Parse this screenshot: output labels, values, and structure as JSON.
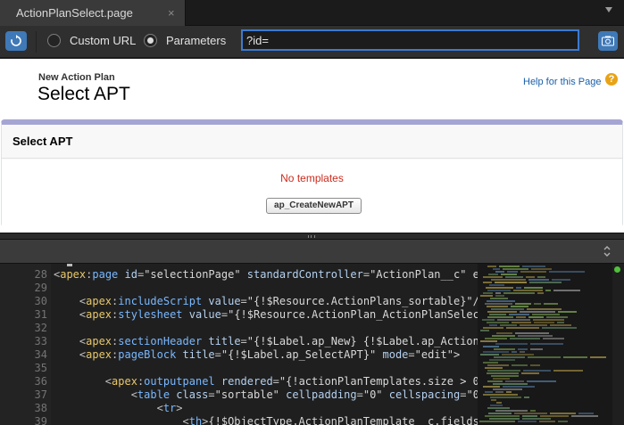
{
  "tab": {
    "title": "ActionPlanSelect.page",
    "close_glyph": "×"
  },
  "urlbar": {
    "custom_url_label": "Custom URL",
    "parameters_label": "Parameters",
    "selected_mode": "Parameters",
    "param_value": "?id="
  },
  "preview": {
    "subtitle": "New Action Plan",
    "title": "Select APT",
    "help_link": "Help for this Page",
    "help_icon_glyph": "?",
    "block_title": "Select APT",
    "message": "No templates",
    "create_button": "ap_CreateNewAPT"
  },
  "editor": {
    "line_numbers": [
      "28",
      "29",
      "30",
      "31",
      "32",
      "33",
      "34",
      "35",
      "36",
      "37",
      "38",
      "39"
    ],
    "lines": [
      [
        [
          "t-p",
          "<"
        ],
        [
          "t-ns",
          "apex"
        ],
        [
          "t-p",
          ":"
        ],
        [
          "t-tag",
          "page "
        ],
        [
          "t-attr",
          "id"
        ],
        [
          "t-p",
          "="
        ],
        [
          "t-str",
          "\"selectionPage\" "
        ],
        [
          "t-attr",
          "standardController"
        ],
        [
          "t-p",
          "="
        ],
        [
          "t-str",
          "\"ActionPlan__c\" e"
        ]
      ],
      [],
      [
        [
          "t-p",
          "    <"
        ],
        [
          "t-ns",
          "apex"
        ],
        [
          "t-p",
          ":"
        ],
        [
          "t-tag",
          "includeScript "
        ],
        [
          "t-attr",
          "value"
        ],
        [
          "t-p",
          "="
        ],
        [
          "t-str",
          "\"{!$Resource.ActionPlans_sortable}\"/"
        ]
      ],
      [
        [
          "t-p",
          "    <"
        ],
        [
          "t-ns",
          "apex"
        ],
        [
          "t-p",
          ":"
        ],
        [
          "t-tag",
          "stylesheet "
        ],
        [
          "t-attr",
          "value"
        ],
        [
          "t-p",
          "="
        ],
        [
          "t-str",
          "\"{!$Resource.ActionPlan_ActionPlanSelec"
        ]
      ],
      [],
      [
        [
          "t-p",
          "    <"
        ],
        [
          "t-ns",
          "apex"
        ],
        [
          "t-p",
          ":"
        ],
        [
          "t-tag",
          "sectionHeader "
        ],
        [
          "t-attr",
          "title"
        ],
        [
          "t-p",
          "="
        ],
        [
          "t-str",
          "\"{!$Label.ap_New} {!$Label.ap_Action"
        ]
      ],
      [
        [
          "t-p",
          "    <"
        ],
        [
          "t-ns",
          "apex"
        ],
        [
          "t-p",
          ":"
        ],
        [
          "t-tag",
          "pageBlock "
        ],
        [
          "t-attr",
          "title"
        ],
        [
          "t-p",
          "="
        ],
        [
          "t-str",
          "\"{!$Label.ap_SelectAPT}\" "
        ],
        [
          "t-attr",
          "mode"
        ],
        [
          "t-p",
          "="
        ],
        [
          "t-str",
          "\"edit\">"
        ]
      ],
      [],
      [
        [
          "t-p",
          "        <"
        ],
        [
          "t-ns",
          "apex"
        ],
        [
          "t-p",
          ":"
        ],
        [
          "t-tag",
          "outputpanel "
        ],
        [
          "t-attr",
          "rendered"
        ],
        [
          "t-p",
          "="
        ],
        [
          "t-str",
          "\"{!actionPlanTemplates.size > 0"
        ]
      ],
      [
        [
          "t-p",
          "            <"
        ],
        [
          "t-tag",
          "table "
        ],
        [
          "t-attr",
          "class"
        ],
        [
          "t-p",
          "="
        ],
        [
          "t-str",
          "\"sortable\" "
        ],
        [
          "t-attr",
          "cellpadding"
        ],
        [
          "t-p",
          "="
        ],
        [
          "t-str",
          "\"0\" "
        ],
        [
          "t-attr",
          "cellspacing"
        ],
        [
          "t-p",
          "="
        ],
        [
          "t-str",
          "\"0"
        ]
      ],
      [
        [
          "t-p",
          "                <"
        ],
        [
          "t-tag",
          "tr"
        ],
        [
          "t-p",
          ">"
        ]
      ],
      [
        [
          "t-p",
          "                    <"
        ],
        [
          "t-tag",
          "th"
        ],
        [
          "t-p",
          ">"
        ],
        [
          "t-str",
          "{!$ObjectType.ActionPlanTemplate__c.fields"
        ]
      ]
    ]
  },
  "colors": {
    "accent_blue": "#3f79b8",
    "block_border": "#a5a5d4",
    "error_red": "#cc2b1d",
    "scroll_indicator": "#4fc23a"
  },
  "icons": {
    "refresh": "refresh-icon",
    "camera": "camera-icon",
    "help": "help-icon",
    "splitter": "grip-icon",
    "updown": "updown-arrows-icon",
    "tab_menu": "chevron-down-icon"
  }
}
